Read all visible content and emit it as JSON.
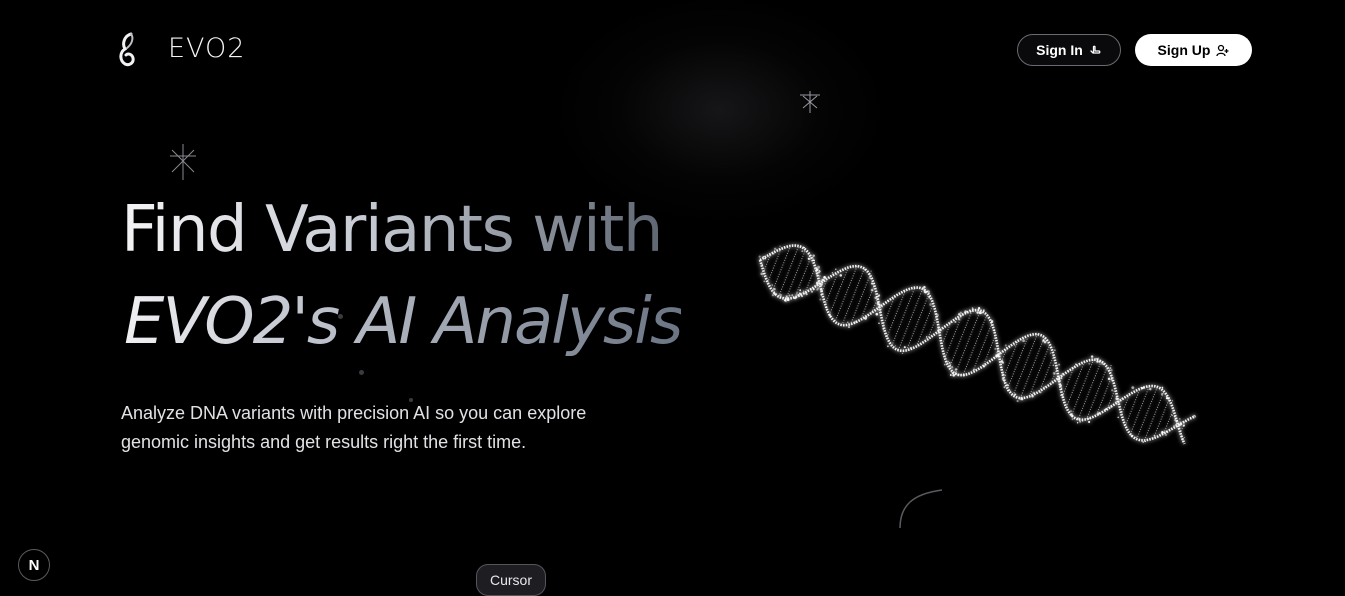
{
  "header": {
    "brand": "EVO2",
    "logo_icon": "evo2-logo-icon",
    "signin_label": "Sign In",
    "signin_icon": "hand-pointer-icon",
    "signup_label": "Sign Up",
    "signup_icon": "user-plus-icon"
  },
  "hero": {
    "title_line1": "Find Variants with",
    "title_line2": "EVO2's AI Analysis",
    "subtitle_line1": "Analyze DNA variants with precision AI so you can explore",
    "subtitle_line2": "genomic insights and get results right the first time."
  },
  "decor": {
    "illustration": "dna-helix-icon",
    "sparkle": "sparkle-icon"
  },
  "overlay": {
    "next_badge": "N",
    "cursor_label": "Cursor"
  },
  "colors": {
    "background": "#000000",
    "primary_button": "#ffffff",
    "text": "#e2e2e6"
  }
}
